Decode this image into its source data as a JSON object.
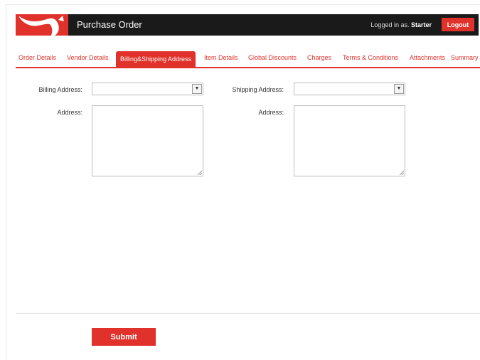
{
  "header": {
    "title": "Purchase Order",
    "logged_in_prefix": "Logged in as.",
    "username": "Starter",
    "logout_label": "Logout"
  },
  "tabs": [
    {
      "label": "Order Details"
    },
    {
      "label": "Vendor Details"
    },
    {
      "label": "Billing&Shipping Address",
      "active": true
    },
    {
      "label": "Item Details"
    },
    {
      "label": "Global Discounts"
    },
    {
      "label": "Charges"
    },
    {
      "label": "Terms & Conditions"
    },
    {
      "label": "Attachments"
    },
    {
      "label": "Summary"
    }
  ],
  "billing": {
    "select_label": "Billing Address:",
    "selected_value": "",
    "address_label": "Address:",
    "address_value": ""
  },
  "shipping": {
    "select_label": "Shipping Address:",
    "selected_value": "",
    "address_label": "Address:",
    "address_value": ""
  },
  "footer": {
    "submit_label": "Submit"
  },
  "colors": {
    "accent": "#e0312a",
    "header_bg": "#1a1a1a"
  }
}
